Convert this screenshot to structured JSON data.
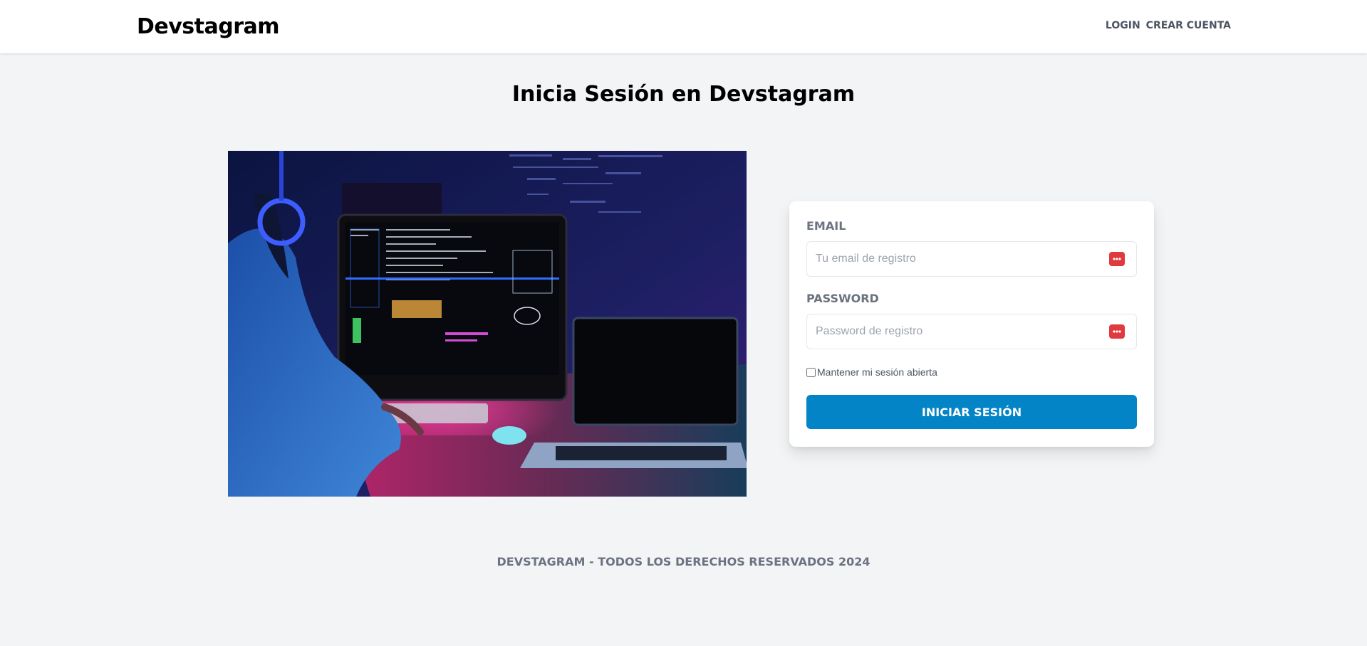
{
  "header": {
    "brand": "Devstagram",
    "nav": {
      "login": "LOGIN",
      "signup": "CREAR CUENTA"
    }
  },
  "page": {
    "title": "Inicia Sesión en Devstagram"
  },
  "hero": {
    "icon": "developer-workstation-image"
  },
  "form": {
    "email_label": "EMAIL",
    "email_placeholder": "Tu email de registro",
    "password_label": "PASSWORD",
    "password_placeholder": "Password de registro",
    "field_icon": "password-manager-icon",
    "field_icon_color": "#e0393e",
    "remember_label": "Mantener mi sesión abierta",
    "remember_checked": false,
    "submit_label": "INICIAR SESIÓN",
    "submit_color": "#0284c7"
  },
  "footer": {
    "text": "DEVSTAGRAM - TODOS LOS DERECHOS RESERVADOS 2024"
  }
}
